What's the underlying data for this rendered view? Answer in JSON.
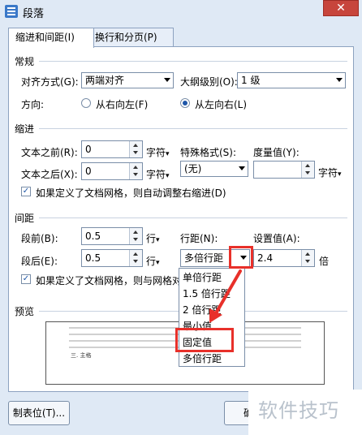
{
  "window": {
    "title": "段落",
    "close_label": "✕"
  },
  "tabs": [
    {
      "label": "缩进和间距(I)",
      "active": true
    },
    {
      "label": "换行和分页(P)",
      "active": false
    }
  ],
  "general": {
    "section_label": "常规",
    "alignment_label": "对齐方式(G):",
    "alignment_value": "两端对齐",
    "outline_label": "大纲级别(O):",
    "outline_value": "1 级",
    "direction_label": "方向:",
    "rtl_label": "从右向左(F)",
    "ltr_label": "从左向右(L)"
  },
  "indent": {
    "section_label": "缩进",
    "before_label": "文本之前(R):",
    "before_value": "0",
    "before_unit": "字符",
    "after_label": "文本之后(X):",
    "after_value": "0",
    "after_unit": "字符",
    "special_label": "特殊格式(S):",
    "special_value": "(无)",
    "measure_label": "度量值(Y):",
    "measure_value": "",
    "measure_unit": "字符",
    "grid_checkbox_label": "如果定义了文档网格，则自动调整右缩进(D)"
  },
  "spacing": {
    "section_label": "间距",
    "before_label": "段前(B):",
    "before_value": "0.5",
    "before_unit": "行",
    "after_label": "段后(E):",
    "after_value": "0.5",
    "after_unit": "行",
    "line_label": "行距(N):",
    "line_value": "多倍行距",
    "setting_label": "设置值(A):",
    "setting_value": "2.4",
    "setting_unit": "倍",
    "grid_checkbox_label": "如果定义了文档网格，则与网格对"
  },
  "line_spacing_menu": [
    "单倍行距",
    "1.5 倍行距",
    "2 倍行距",
    "最小值",
    "固定值",
    "多倍行距"
  ],
  "preview": {
    "section_label": "预览",
    "sample_text": "前一段落前一段落前一段落前一段落前一段落前一段落前一段落前一段落前一段落前一段落",
    "bold_text": "三. 主格"
  },
  "buttons": {
    "tabs_label": "制表位(T)...",
    "ok_label": "确"
  },
  "watermark": "软件技巧",
  "colors": {
    "highlight": "#e8302a",
    "accent": "#1e56a8"
  }
}
